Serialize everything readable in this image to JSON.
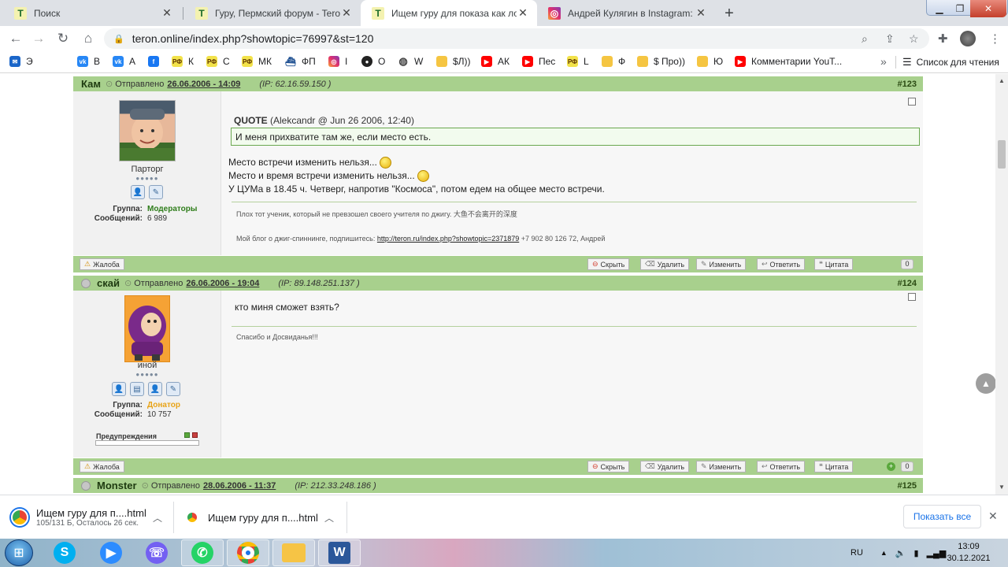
{
  "browser": {
    "tabs": [
      {
        "title": "Поиск",
        "favicon": "teron-icon",
        "active": false
      },
      {
        "title": "Гуру, Пермский форум - Teron.onl",
        "favicon": "teron-icon",
        "active": false
      },
      {
        "title": "Ищем гуру для показа как ловят",
        "favicon": "teron-icon",
        "active": true
      },
      {
        "title": "Андрей Кулягин в Instagram: «Се",
        "favicon": "instagram-icon",
        "active": false
      }
    ],
    "url": "teron.online/index.php?showtopic=76997&st=120",
    "bookmarks": [
      {
        "label": "Э",
        "icon": "mail-icon"
      },
      {
        "label": "В",
        "icon": "vk-icon"
      },
      {
        "label": "А",
        "icon": "vk-icon"
      },
      {
        "label": "",
        "icon": "facebook-icon"
      },
      {
        "label": "К",
        "icon": "rf-icon"
      },
      {
        "label": "С",
        "icon": "rf-icon"
      },
      {
        "label": "МК",
        "icon": "rf-icon"
      },
      {
        "label": "ФП",
        "icon": "ship-icon"
      },
      {
        "label": "I",
        "icon": "instagram-icon"
      },
      {
        "label": "О",
        "icon": "github-icon"
      },
      {
        "label": "W",
        "icon": "globe-icon"
      },
      {
        "label": "$Л))",
        "icon": "folder-icon"
      },
      {
        "label": "АК",
        "icon": "youtube-icon"
      },
      {
        "label": "Пес",
        "icon": "youtube-icon"
      },
      {
        "label": "L",
        "icon": "rf-icon"
      },
      {
        "label": "Ф",
        "icon": "folder-icon"
      },
      {
        "label": "$ Про))",
        "icon": "folder-icon"
      },
      {
        "label": "Ю",
        "icon": "folder-icon"
      },
      {
        "label": "Комментарии YouT...",
        "icon": "youtube-icon"
      }
    ],
    "more": "»",
    "reading_list": "Список для чтения"
  },
  "posts": [
    {
      "user": "Кам",
      "sent_label": "Отправлено",
      "date": "26.06.2006 - 14:09",
      "ip": "(IP: 62.16.59.150 )",
      "number": "#123",
      "rank": "Парторг",
      "pips": "●●●●●",
      "group_label": "Группа:",
      "group": "Модераторы",
      "messages_label": "Сообщений:",
      "messages": "6 989",
      "quote_title": "QUOTE",
      "quote_meta": "(Alekcandr @ Jun 26 2006, 12:40)",
      "quote_text": "И меня прихватите там же, если место есть.",
      "lines": [
        "Место встречи изменить нельзя...",
        "Место и время встречи изменить нельзя...",
        "У ЦУМа в 18.45 ч. Четверг, напротив \"Космоса\", потом едем на общее место встречи."
      ],
      "sig1": "Плох тот ученик, который не превзошел своего учителя по джигу. 大鱼不会离开的深度",
      "sig2_prefix": "Мой блог о джиг-спиннинге, подпишитесь:",
      "sig2_link": "http://teron.ru/index.php?showtopic=2371879",
      "sig2_suffix": "+7 902 80 126 72, Андрей",
      "count": "0"
    },
    {
      "user": "скай",
      "sent_label": "Отправлено",
      "date": "26.06.2006 - 19:04",
      "ip": "(IP: 89.148.251.137 )",
      "number": "#124",
      "rank": "иной",
      "pips": "●●●●●",
      "group_label": "Группа:",
      "group": "Донатор",
      "messages_label": "Сообщений:",
      "messages": "10 757",
      "text": "кто миня сможет взять?",
      "sig": "Спасибо и Досвиданья!!!",
      "warnings": "Предупреждения",
      "count": "0"
    },
    {
      "user": "Monster",
      "sent_label": "Отправлено",
      "date": "28.06.2006 - 11:37",
      "ip": "(IP: 212.33.248.186 )",
      "number": "#125"
    }
  ],
  "actions": {
    "complaint": "Жалоба",
    "hide": "Скрыть",
    "delete": "Удалить",
    "edit": "Изменить",
    "reply": "Ответить",
    "quote": "Цитата"
  },
  "downloads": [
    {
      "name": "Ищем гуру для п....html",
      "status": "105/131 Б, Осталось 26 сек."
    },
    {
      "name": "Ищем гуру для п....html",
      "status": ""
    }
  ],
  "show_all": "Показать все",
  "taskbar": {
    "lang": "RU",
    "time": "13:09",
    "date": "30.12.2021",
    "apps": [
      "skype-icon",
      "zoom-icon",
      "viber-icon",
      "whatsapp-icon",
      "chrome-icon",
      "explorer-icon",
      "word-icon"
    ]
  },
  "colors": {
    "post_header": "#a8d08d",
    "quote_border": "#6aa84f",
    "group_moderators": "#2e7d1a",
    "group_donator": "#e8a317"
  }
}
